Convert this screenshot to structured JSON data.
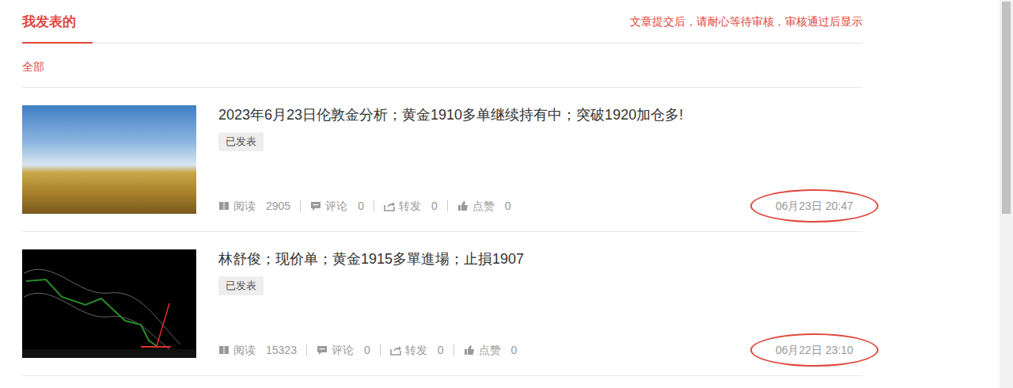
{
  "header": {
    "tab": {
      "label": "我发表的",
      "selected": true
    },
    "notice": "文章提交后，请耐心等待审核，审核通过后显示"
  },
  "filters": [
    {
      "label": "全部",
      "selected": true
    }
  ],
  "articles": [
    {
      "title": "2023年6月23日伦敦金分析；黄金1910多单继续持有中；突破1920加仓多!",
      "status": "已发表",
      "kind": "photo",
      "stats": [
        {
          "kind": "read",
          "label": "阅读",
          "value": "2905"
        },
        {
          "kind": "comment",
          "label": "评论",
          "value": "0"
        },
        {
          "kind": "share",
          "label": "转发",
          "value": "0"
        },
        {
          "kind": "like",
          "label": "点赞",
          "value": "0"
        }
      ],
      "date": "06月23日 20:47",
      "highlighted": true
    },
    {
      "title": "林舒俊；现价单；黄金1915多單進場；止損1907",
      "status": "已发表",
      "kind": "chart",
      "stats": [
        {
          "kind": "read",
          "label": "阅读",
          "value": "15323"
        },
        {
          "kind": "comment",
          "label": "评论",
          "value": "0"
        },
        {
          "kind": "share",
          "label": "转发",
          "value": "0"
        },
        {
          "kind": "like",
          "label": "点赞",
          "value": "0"
        }
      ],
      "date": "06月22日 23:10",
      "highlighted": true
    }
  ]
}
